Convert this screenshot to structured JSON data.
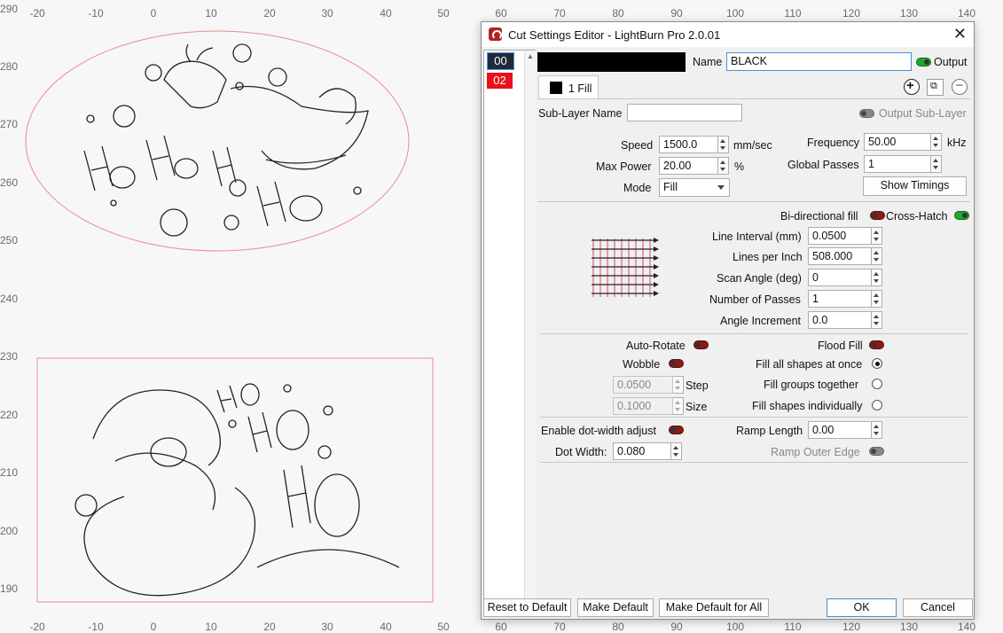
{
  "ruler": {
    "top": [
      "-20",
      "-10",
      "0",
      "10",
      "20",
      "30",
      "40",
      "50",
      "60",
      "70",
      "80",
      "90",
      "100",
      "110",
      "120",
      "130",
      "140"
    ],
    "left": [
      "290",
      "280",
      "270",
      "260",
      "250",
      "240",
      "230",
      "220",
      "210",
      "200",
      "190"
    ]
  },
  "dialog": {
    "title": "Cut Settings Editor - LightBurn Pro 2.0.01",
    "layers": [
      {
        "label": "00",
        "color": "#1e2a3a"
      },
      {
        "label": "02",
        "color": "#e8111b"
      }
    ],
    "name_label": "Name",
    "name_value": "BLACK",
    "output_label": "Output",
    "output_on": true,
    "swatch_color": "#000000",
    "tab_label": "1 Fill",
    "sublayer_label": "Sub-Layer Name",
    "sublayer_value": "",
    "output_sublayer_label": "Output Sub-Layer",
    "speed_label": "Speed",
    "speed_value": "1500.0",
    "speed_unit": "mm/sec",
    "maxpower_label": "Max Power",
    "maxpower_value": "20.00",
    "maxpower_unit": "%",
    "mode_label": "Mode",
    "mode_value": "Fill",
    "frequency_label": "Frequency",
    "frequency_value": "50.00",
    "frequency_unit": "kHz",
    "globalpasses_label": "Global Passes",
    "globalpasses_value": "1",
    "show_timings": "Show Timings",
    "bidir_label": "Bi-directional fill",
    "bidir_on": false,
    "crosshatch_label": "Cross-Hatch",
    "crosshatch_on": true,
    "lineinterval_label": "Line Interval (mm)",
    "lineinterval_value": "0.0500",
    "lpi_label": "Lines per Inch",
    "lpi_value": "508.000",
    "scanangle_label": "Scan Angle (deg)",
    "scanangle_value": "0",
    "numpasses_label": "Number of Passes",
    "numpasses_value": "1",
    "angleinc_label": "Angle Increment",
    "angleinc_value": "0.0",
    "autorotate_label": "Auto-Rotate",
    "floodfill_label": "Flood Fill",
    "wobble_label": "Wobble",
    "step_value": "0.0500",
    "step_label": "Step",
    "size_value": "0.1000",
    "size_label": "Size",
    "fill_all_label": "Fill all shapes at once",
    "fill_groups_label": "Fill groups together",
    "fill_indiv_label": "Fill shapes individually",
    "dotwidth_adj_label": "Enable dot-width adjust",
    "dotwidth_label": "Dot Width:",
    "dotwidth_value": "0.080",
    "ramp_length_label": "Ramp Length",
    "ramp_length_value": "0.00",
    "ramp_outer_label": "Ramp Outer Edge",
    "buttons": {
      "reset": "Reset to Default",
      "make_default": "Make Default",
      "make_default_all": "Make Default for All",
      "ok": "OK",
      "cancel": "Cancel"
    }
  }
}
